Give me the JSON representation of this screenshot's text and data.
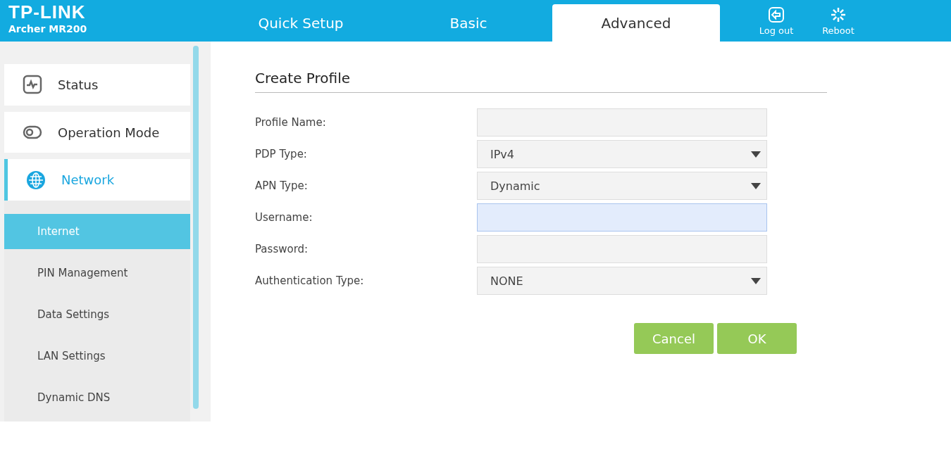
{
  "header": {
    "logo": "TP-LINK",
    "model": "Archer MR200"
  },
  "tabs": [
    {
      "label": "Quick Setup",
      "selected": false
    },
    {
      "label": "Basic",
      "selected": false
    },
    {
      "label": "Advanced",
      "selected": true
    }
  ],
  "actions": [
    {
      "kind": "logout",
      "label": "Log out"
    },
    {
      "kind": "reboot",
      "label": "Reboot"
    }
  ],
  "sidebar": {
    "items": [
      {
        "kind": "status",
        "label": "Status",
        "selected": false
      },
      {
        "kind": "mode",
        "label": "Operation Mode",
        "selected": false
      },
      {
        "kind": "network",
        "label": "Network",
        "selected": true,
        "expanded": true,
        "children": [
          {
            "label": "Internet",
            "selected": true
          },
          {
            "label": "PIN Management",
            "selected": false
          },
          {
            "label": "Data Settings",
            "selected": false
          },
          {
            "label": "LAN Settings",
            "selected": false
          },
          {
            "label": "Dynamic DNS",
            "selected": false
          }
        ]
      }
    ]
  },
  "form": {
    "title": "Create Profile",
    "fields": [
      {
        "kind": "text",
        "label": "Profile Name:",
        "focused": false
      },
      {
        "kind": "select",
        "label": "PDP Type:",
        "value": "IPv4"
      },
      {
        "kind": "select",
        "label": "APN Type:",
        "value": "Dynamic"
      },
      {
        "kind": "text",
        "label": "Username:",
        "focused": true
      },
      {
        "kind": "text",
        "label": "Password:",
        "focused": false
      },
      {
        "kind": "select",
        "label": "Authentication Type:",
        "value": "NONE"
      }
    ],
    "buttons": [
      "Cancel",
      "OK"
    ]
  }
}
